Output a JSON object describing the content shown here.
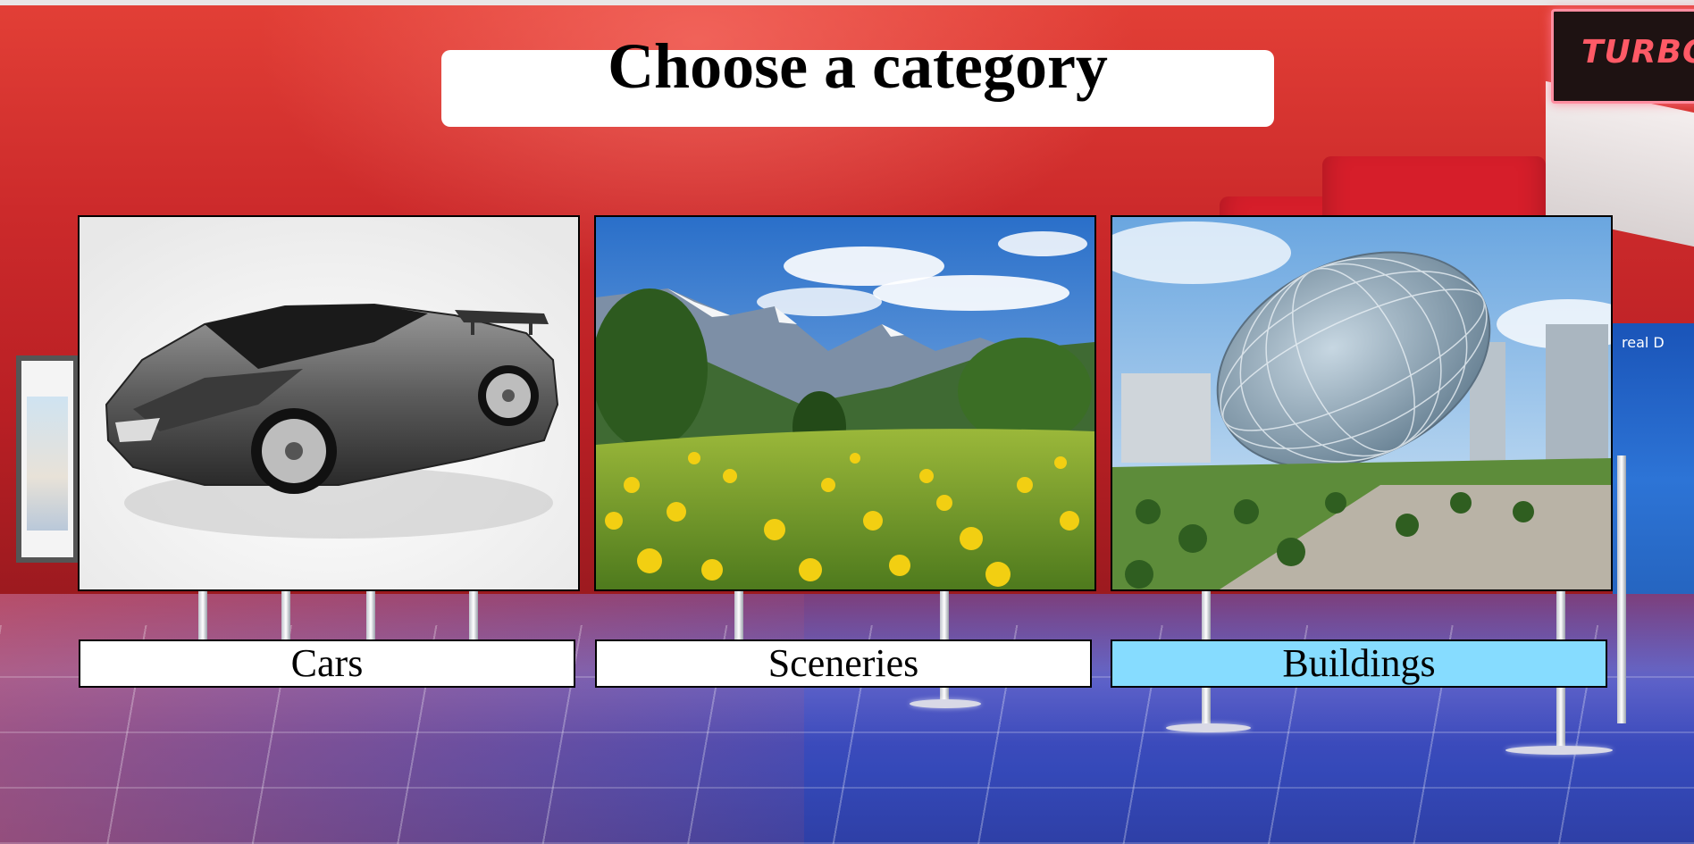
{
  "page": {
    "title": "Choose a category"
  },
  "background": {
    "sign_text": "TURBO",
    "banner_text": "real D"
  },
  "categories": [
    {
      "label": "Cars",
      "image": "sports-car-photo",
      "selected": false
    },
    {
      "label": "Sceneries",
      "image": "mountain-meadow-photo",
      "selected": false
    },
    {
      "label": "Buildings",
      "image": "egg-shaped-building-photo",
      "selected": true
    }
  ],
  "colors": {
    "selected_label_bg": "#86dcff",
    "label_bg": "#ffffff",
    "title_bg": "#ffffff",
    "wall_red": "#cc2a2b"
  }
}
